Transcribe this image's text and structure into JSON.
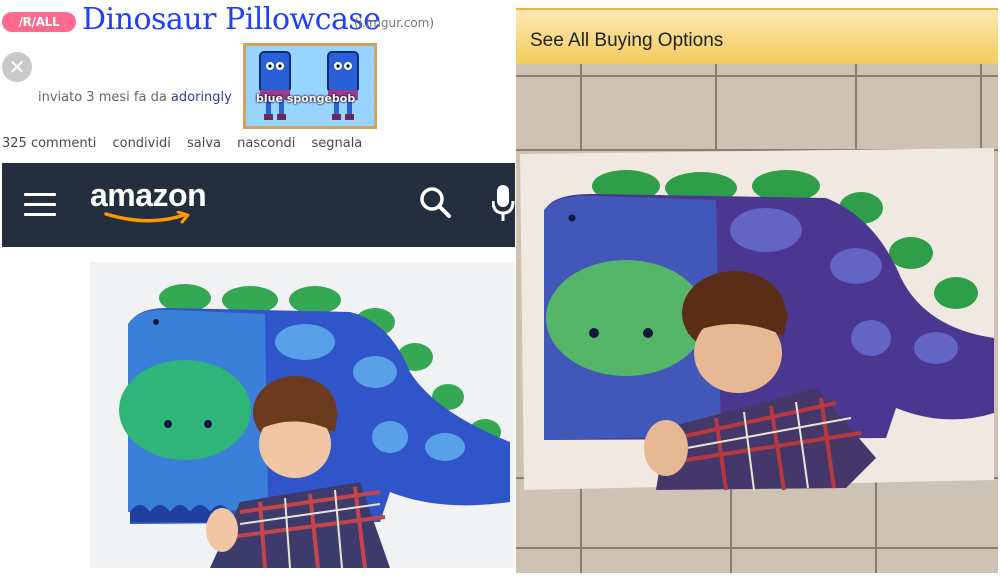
{
  "post": {
    "tag": "/R/ALL",
    "title": "Dinosaur Pillowcase",
    "domain": "(i.imgur.com)",
    "submitted_prefix": "inviato 3 mesi fa da",
    "author": "adoringly",
    "flair_text": "blue spongebob",
    "actions": [
      "325 commenti",
      "condividi",
      "salva",
      "nascondi",
      "segnala"
    ]
  },
  "amazon": {
    "logo": "amazon",
    "icons": [
      "menu-icon",
      "search-icon",
      "microphone-icon"
    ],
    "colors": {
      "bar": "#232f3e",
      "smile": "#ff9900"
    }
  },
  "right": {
    "buy_label": "See All Buying Options"
  }
}
